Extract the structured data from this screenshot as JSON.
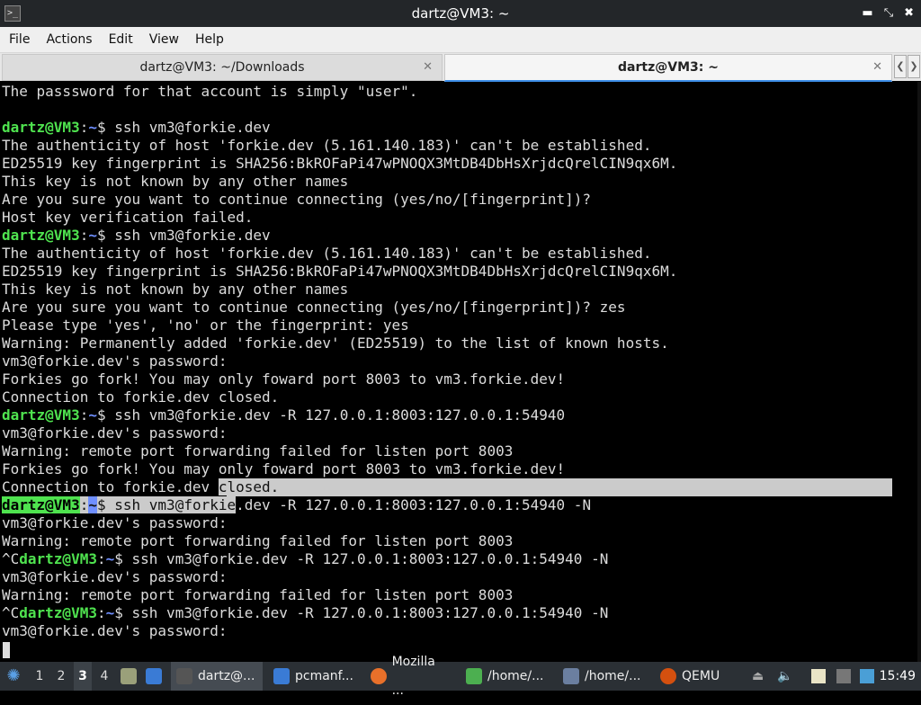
{
  "window": {
    "title": "dartz@VM3: ~"
  },
  "menu": [
    "File",
    "Actions",
    "Edit",
    "View",
    "Help"
  ],
  "tabs": [
    {
      "label": "dartz@VM3: ~/Downloads",
      "active": false
    },
    {
      "label": "dartz@VM3: ~",
      "active": true
    }
  ],
  "prompt": {
    "user_host": "dartz@VM3",
    "sep": ":",
    "path": "~",
    "sigil": "$"
  },
  "terminal": {
    "lines": [
      "The passsword for that account is simply \"user\".",
      "",
      {
        "prompt": true,
        "cmd": " ssh vm3@forkie.dev"
      },
      "The authenticity of host 'forkie.dev (5.161.140.183)' can't be established.",
      "ED25519 key fingerprint is SHA256:BkROFaPi47wPNOQX3MtDB4DbHsXrjdcQrelCIN9qx6M.",
      "This key is not known by any other names",
      "Are you sure you want to continue connecting (yes/no/[fingerprint])?",
      "Host key verification failed.",
      {
        "prompt": true,
        "cmd": " ssh vm3@forkie.dev"
      },
      "The authenticity of host 'forkie.dev (5.161.140.183)' can't be established.",
      "ED25519 key fingerprint is SHA256:BkROFaPi47wPNOQX3MtDB4DbHsXrjdcQrelCIN9qx6M.",
      "This key is not known by any other names",
      "Are you sure you want to continue connecting (yes/no/[fingerprint])? zes",
      "Please type 'yes', 'no' or the fingerprint: yes",
      "Warning: Permanently added 'forkie.dev' (ED25519) to the list of known hosts.",
      "vm3@forkie.dev's password:",
      "Forkies go fork! You may only foward port 8003 to vm3.forkie.dev!",
      "Connection to forkie.dev closed.",
      {
        "prompt": true,
        "cmd": " ssh vm3@forkie.dev -R 127.0.0.1:8003:127.0.0.1:54940"
      },
      "vm3@forkie.dev's password:",
      "Warning: remote port forwarding failed for listen port 8003",
      "Forkies go fork! You may only foward port 8003 to vm3.forkie.dev!",
      {
        "text_a": "Connection to forkie.dev ",
        "text_hl": "closed."
      },
      {
        "prompt": true,
        "hl_prompt": true,
        "cmd_hl": " ssh vm3@forkie",
        "cmd": ".dev -R 127.0.0.1:8003:127.0.0.1:54940 -N"
      },
      "vm3@forkie.dev's password:",
      "Warning: remote port forwarding failed for listen port 8003",
      {
        "prefix": "^C",
        "prompt": true,
        "cmd": " ssh vm3@forkie.dev -R 127.0.0.1:8003:127.0.0.1:54940 -N"
      },
      "vm3@forkie.dev's password:",
      "Warning: remote port forwarding failed for listen port 8003",
      {
        "prefix": "^C",
        "prompt": true,
        "cmd": " ssh vm3@forkie.dev -R 127.0.0.1:8003:127.0.0.1:54940 -N"
      },
      "vm3@forkie.dev's password:"
    ]
  },
  "taskbar": {
    "workspaces": [
      "1",
      "2",
      "3",
      "4"
    ],
    "active_workspace": "3",
    "tasks": [
      {
        "label": "dartz@...",
        "icon": "terminal-icon",
        "active": true
      },
      {
        "label": "pcmanf...",
        "icon": "folder-icon",
        "active": false
      },
      {
        "label": "Mozilla ...",
        "icon": "firefox-icon",
        "active": false
      },
      {
        "label": "/home/...",
        "icon": "editor-icon",
        "active": false
      },
      {
        "label": "/home/...",
        "icon": "pen-icon",
        "active": false
      },
      {
        "label": "QEMU",
        "icon": "qemu-icon",
        "active": false
      }
    ],
    "clock": "15:49"
  }
}
